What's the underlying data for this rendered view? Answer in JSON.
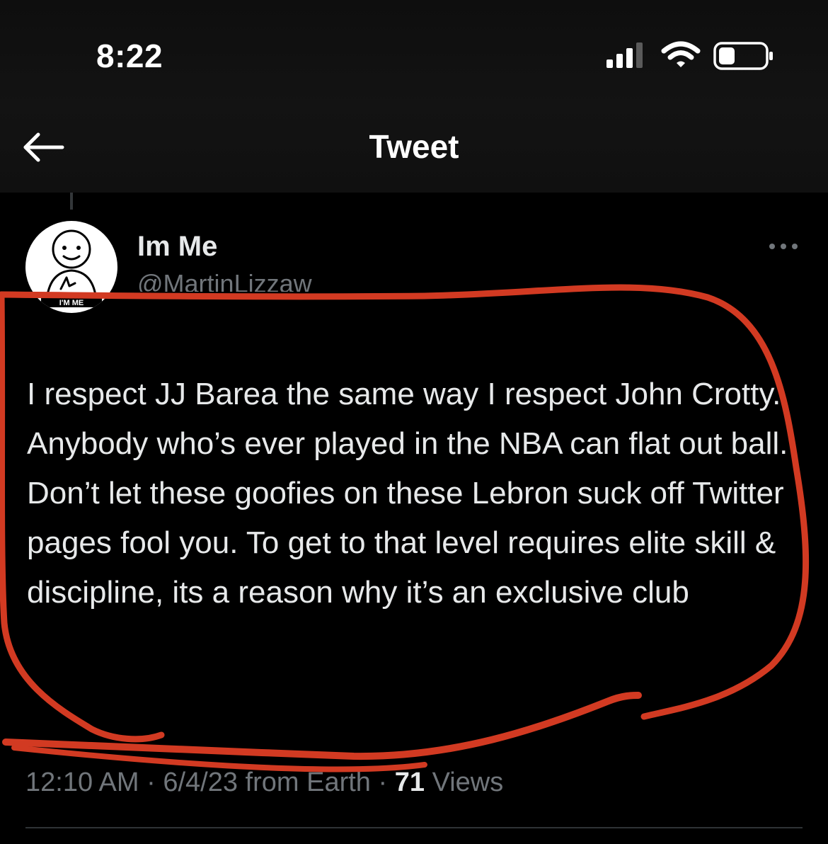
{
  "status_bar": {
    "time": "8:22"
  },
  "nav": {
    "title": "Tweet",
    "back_icon": "arrow-left-icon"
  },
  "tweet": {
    "display_name": "Im Me",
    "handle": "@MartinLizzaw",
    "text": "I respect JJ Barea the same way I respect John Crotty. Anybody who’s ever played in the NBA can flat out ball. Don’t let these goofies on these Lebron suck off Twitter pages fool you. To get to that level requires elite skill & discipline, its a reason why it’s an exclusive club",
    "time": "12:10 AM",
    "separator": "·",
    "date_source": "6/4/23 from Earth",
    "views_count": "71",
    "views_label": "Views",
    "avatar_badge_text": "I'M ME",
    "more_icon": "more-horizontal-icon"
  },
  "colors": {
    "background": "#000000",
    "primary_text": "#e7e9ea",
    "secondary_text": "#71767b",
    "annotation_red": "#d23a22"
  }
}
